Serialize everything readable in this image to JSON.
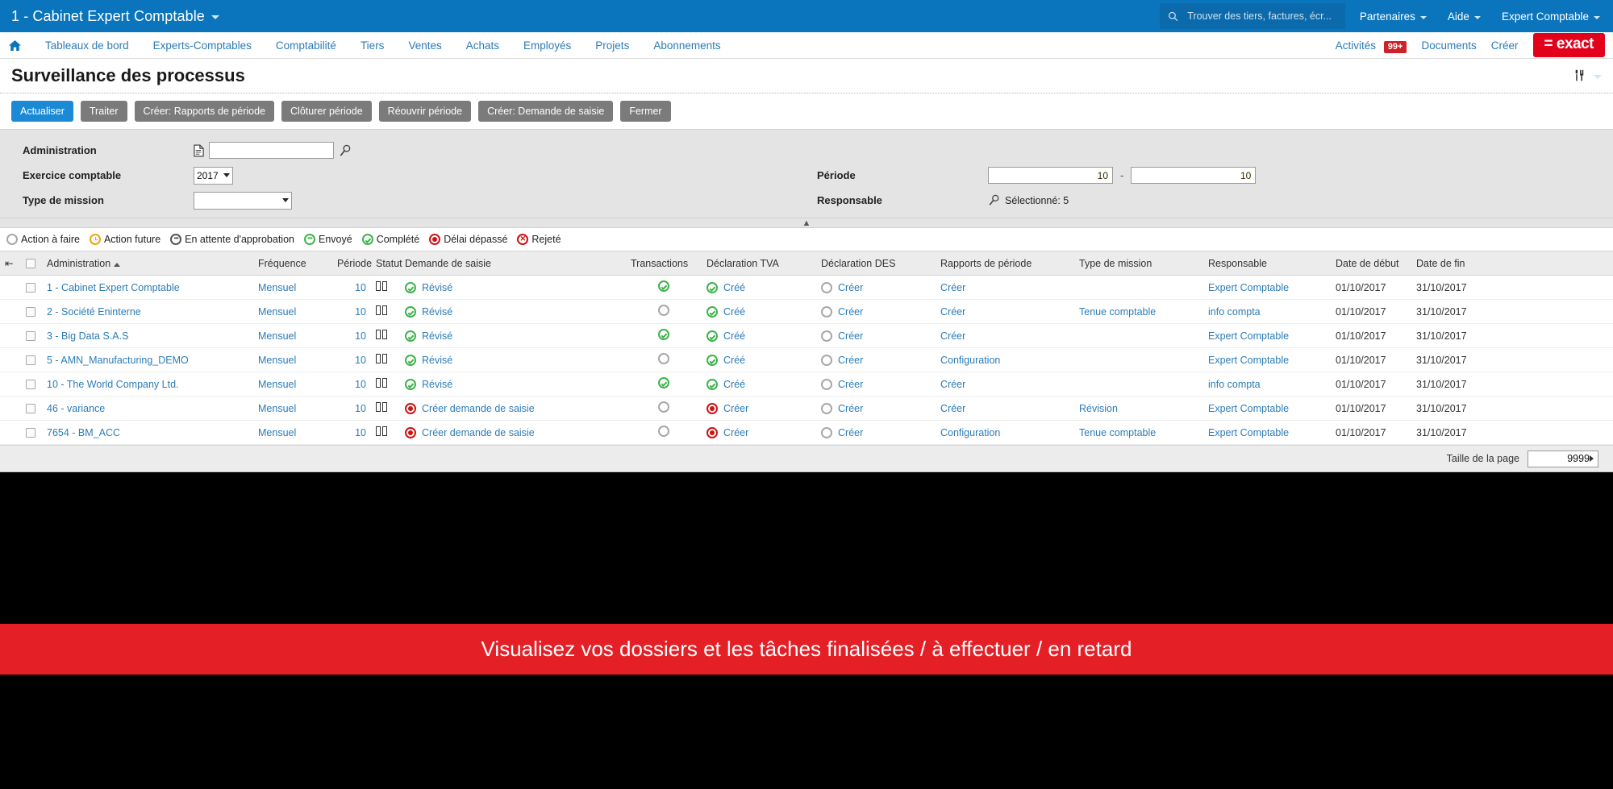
{
  "topbar": {
    "company": "1 - Cabinet Expert Comptable",
    "search_placeholder": "Trouver des tiers, factures, écr...",
    "menus": [
      "Partenaires",
      "Aide",
      "Expert Comptable"
    ]
  },
  "nav": {
    "items": [
      "Tableaux de bord",
      "Experts-Comptables",
      "Comptabilité",
      "Tiers",
      "Ventes",
      "Achats",
      "Employés",
      "Projets",
      "Abonnements"
    ],
    "right": {
      "activities_label": "Activités",
      "activities_badge": "99+",
      "documents_label": "Documents",
      "create_label": "Créer",
      "logo_text": "= exact"
    }
  },
  "page": {
    "title": "Surveillance des processus"
  },
  "toolbar": {
    "buttons": [
      {
        "label": "Actualiser",
        "primary": true
      },
      {
        "label": "Traiter",
        "primary": false
      },
      {
        "label": "Créer: Rapports de période",
        "primary": false
      },
      {
        "label": "Clôturer période",
        "primary": false
      },
      {
        "label": "Réouvrir période",
        "primary": false
      },
      {
        "label": "Créer: Demande de saisie",
        "primary": false
      },
      {
        "label": "Fermer",
        "primary": false
      }
    ]
  },
  "filters": {
    "administration_label": "Administration",
    "administration_value": "",
    "exercice_label": "Exercice comptable",
    "exercice_value": "2017",
    "type_mission_label": "Type de mission",
    "type_mission_value": "",
    "periode_label": "Période",
    "periode_from": "10",
    "periode_to": "10",
    "responsable_label": "Responsable",
    "responsable_value": "Sélectionné: 5"
  },
  "legend": [
    {
      "label": "Action à faire",
      "icon": "todo"
    },
    {
      "label": "Action future",
      "icon": "future"
    },
    {
      "label": "En attente d'approbation",
      "icon": "approval"
    },
    {
      "label": "Envoyé",
      "icon": "sent"
    },
    {
      "label": "Complété",
      "icon": "done"
    },
    {
      "label": "Délai dépassé",
      "icon": "late"
    },
    {
      "label": "Rejeté",
      "icon": "rejected"
    }
  ],
  "table": {
    "columns": [
      "Administration",
      "Fréquence",
      "Période",
      "Statut",
      "Demande de saisie",
      "Transactions",
      "Déclaration TVA",
      "Déclaration DES",
      "Rapports de période",
      "Type de mission",
      "Responsable",
      "Date de début",
      "Date de fin"
    ],
    "sort_column": "Administration",
    "sort_direction": "asc",
    "rows": [
      {
        "administration": "1 - Cabinet Expert Comptable",
        "frequence": "Mensuel",
        "periode": "10",
        "demande_icon": "done",
        "demande": "Révisé",
        "transactions_icon": "done",
        "tva_icon": "done",
        "tva": "Créé",
        "des_icon": "todo",
        "des": "Créer",
        "rapports": "Créer",
        "type_mission": "",
        "responsable": "Expert Comptable",
        "date_debut": "01/10/2017",
        "date_fin": "31/10/2017"
      },
      {
        "administration": "2 - Société Eninterne",
        "frequence": "Mensuel",
        "periode": "10",
        "demande_icon": "done",
        "demande": "Révisé",
        "transactions_icon": "todo",
        "tva_icon": "done",
        "tva": "Créé",
        "des_icon": "todo",
        "des": "Créer",
        "rapports": "Créer",
        "type_mission": "Tenue comptable",
        "responsable": "info compta",
        "date_debut": "01/10/2017",
        "date_fin": "31/10/2017"
      },
      {
        "administration": "3 - Big Data S.A.S",
        "frequence": "Mensuel",
        "periode": "10",
        "demande_icon": "done",
        "demande": "Révisé",
        "transactions_icon": "done",
        "tva_icon": "done",
        "tva": "Créé",
        "des_icon": "todo",
        "des": "Créer",
        "rapports": "Créer",
        "type_mission": "",
        "responsable": "Expert Comptable",
        "date_debut": "01/10/2017",
        "date_fin": "31/10/2017"
      },
      {
        "administration": "5 - AMN_Manufacturing_DEMO",
        "frequence": "Mensuel",
        "periode": "10",
        "demande_icon": "done",
        "demande": "Révisé",
        "transactions_icon": "todo",
        "tva_icon": "done",
        "tva": "Créé",
        "des_icon": "todo",
        "des": "Créer",
        "rapports": "Configuration",
        "type_mission": "",
        "responsable": "Expert Comptable",
        "date_debut": "01/10/2017",
        "date_fin": "31/10/2017"
      },
      {
        "administration": "10 - The World Company Ltd.",
        "frequence": "Mensuel",
        "periode": "10",
        "demande_icon": "done",
        "demande": "Révisé",
        "transactions_icon": "done",
        "tva_icon": "done",
        "tva": "Créé",
        "des_icon": "todo",
        "des": "Créer",
        "rapports": "Créer",
        "type_mission": "",
        "responsable": "info compta",
        "date_debut": "01/10/2017",
        "date_fin": "31/10/2017"
      },
      {
        "administration": "46 - variance",
        "frequence": "Mensuel",
        "periode": "10",
        "demande_icon": "late",
        "demande": "Créer demande de saisie",
        "transactions_icon": "todo",
        "tva_icon": "late",
        "tva": "Créer",
        "des_icon": "todo",
        "des": "Créer",
        "rapports": "Créer",
        "type_mission": "Révision",
        "responsable": "Expert Comptable",
        "date_debut": "01/10/2017",
        "date_fin": "31/10/2017"
      },
      {
        "administration": "7654 - BM_ACC",
        "frequence": "Mensuel",
        "periode": "10",
        "demande_icon": "late",
        "demande": "Créer demande de saisie",
        "transactions_icon": "todo",
        "tva_icon": "late",
        "tva": "Créer",
        "des_icon": "todo",
        "des": "Créer",
        "rapports": "Configuration",
        "type_mission": "Tenue comptable",
        "responsable": "Expert Comptable",
        "date_debut": "01/10/2017",
        "date_fin": "31/10/2017"
      }
    ]
  },
  "footer": {
    "pagesize_label": "Taille de la page",
    "pagesize_value": "9999"
  },
  "banner": {
    "text": "Visualisez vos dossiers et les tâches finalisées / à effectuer / en retard"
  },
  "colors": {
    "brand_blue": "#0a74bc",
    "link_blue": "#2b7cb8",
    "accent_red": "#e2001a",
    "banner_red": "#e41f26",
    "status_green": "#3cb44a",
    "status_orange": "#f2a20c",
    "status_red": "#cf1111"
  }
}
